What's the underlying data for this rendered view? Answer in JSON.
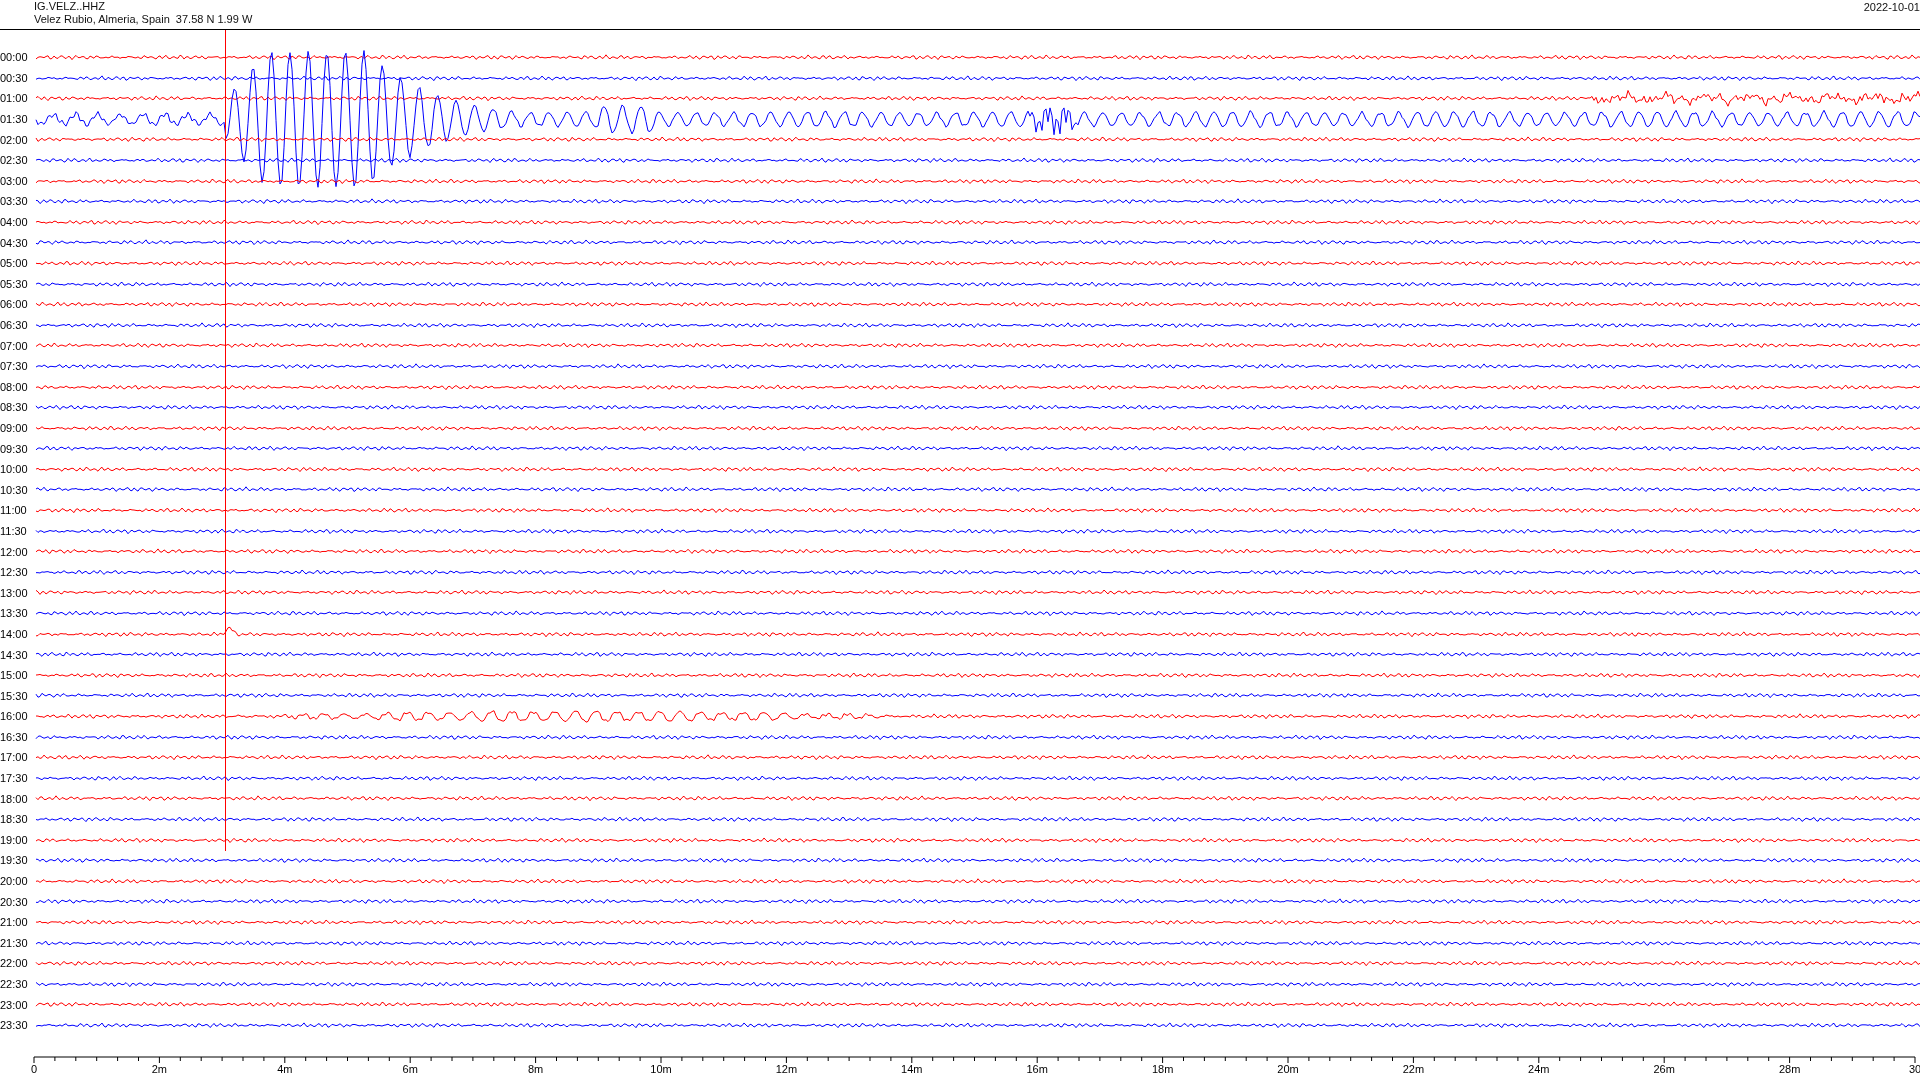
{
  "header": {
    "station": "IG.VELZ..HHZ",
    "location": "Velez Rubio, Almeria, Spain  37.58 N 1.99 W",
    "date": "2022-10-01"
  },
  "rows": [
    {
      "time": "00:00",
      "color": "#ff0000"
    },
    {
      "time": "00:30",
      "color": "#0000ff"
    },
    {
      "time": "01:00",
      "color": "#ff0000"
    },
    {
      "time": "01:30",
      "color": "#0000ff"
    },
    {
      "time": "02:00",
      "color": "#ff0000"
    },
    {
      "time": "02:30",
      "color": "#0000ff"
    },
    {
      "time": "03:00",
      "color": "#ff0000"
    },
    {
      "time": "03:30",
      "color": "#0000ff"
    },
    {
      "time": "04:00",
      "color": "#ff0000"
    },
    {
      "time": "04:30",
      "color": "#0000ff"
    },
    {
      "time": "05:00",
      "color": "#ff0000"
    },
    {
      "time": "05:30",
      "color": "#0000ff"
    },
    {
      "time": "06:00",
      "color": "#ff0000"
    },
    {
      "time": "06:30",
      "color": "#0000ff"
    },
    {
      "time": "07:00",
      "color": "#ff0000"
    },
    {
      "time": "07:30",
      "color": "#0000ff"
    },
    {
      "time": "08:00",
      "color": "#ff0000"
    },
    {
      "time": "08:30",
      "color": "#0000ff"
    },
    {
      "time": "09:00",
      "color": "#ff0000"
    },
    {
      "time": "09:30",
      "color": "#0000ff"
    },
    {
      "time": "10:00",
      "color": "#ff0000"
    },
    {
      "time": "10:30",
      "color": "#0000ff"
    },
    {
      "time": "11:00",
      "color": "#ff0000"
    },
    {
      "time": "11:30",
      "color": "#0000ff"
    },
    {
      "time": "12:00",
      "color": "#ff0000"
    },
    {
      "time": "12:30",
      "color": "#0000ff"
    },
    {
      "time": "13:00",
      "color": "#ff0000"
    },
    {
      "time": "13:30",
      "color": "#0000ff"
    },
    {
      "time": "14:00",
      "color": "#ff0000"
    },
    {
      "time": "14:30",
      "color": "#0000ff"
    },
    {
      "time": "15:00",
      "color": "#ff0000"
    },
    {
      "time": "15:30",
      "color": "#0000ff"
    },
    {
      "time": "16:00",
      "color": "#ff0000"
    },
    {
      "time": "16:30",
      "color": "#0000ff"
    },
    {
      "time": "17:00",
      "color": "#ff0000"
    },
    {
      "time": "17:30",
      "color": "#0000ff"
    },
    {
      "time": "18:00",
      "color": "#ff0000"
    },
    {
      "time": "18:30",
      "color": "#0000ff"
    },
    {
      "time": "19:00",
      "color": "#ff0000"
    },
    {
      "time": "19:30",
      "color": "#0000ff"
    },
    {
      "time": "20:00",
      "color": "#ff0000"
    },
    {
      "time": "20:30",
      "color": "#0000ff"
    },
    {
      "time": "21:00",
      "color": "#ff0000"
    },
    {
      "time": "21:30",
      "color": "#0000ff"
    },
    {
      "time": "22:00",
      "color": "#ff0000"
    },
    {
      "time": "22:30",
      "color": "#0000ff"
    },
    {
      "time": "23:00",
      "color": "#ff0000"
    },
    {
      "time": "23:30",
      "color": "#0000ff"
    }
  ],
  "axis": {
    "ticks": [
      "0",
      "2m",
      "4m",
      "6m",
      "8m",
      "10m",
      "12m",
      "14m",
      "16m",
      "18m",
      "20m",
      "22m",
      "24m",
      "26m",
      "28m",
      "30"
    ]
  }
}
